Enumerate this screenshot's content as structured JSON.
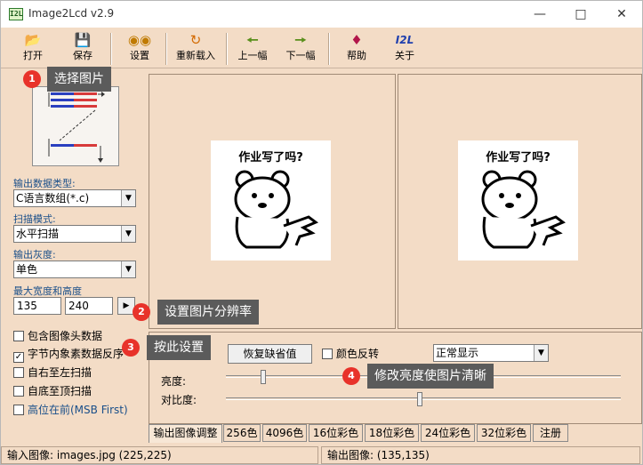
{
  "window": {
    "title": "Image2Lcd v2.9",
    "icon_text": "I2L"
  },
  "toolbar": {
    "open": "打开",
    "save": "保存",
    "settings": "设置",
    "reload": "重新载入",
    "prev": "上一幅",
    "next": "下一幅",
    "help": "帮助",
    "about": "关于",
    "about_icon": "I2L"
  },
  "left": {
    "output_type_label": "输出数据类型:",
    "output_type_value": "C语言数组(*.c)",
    "scan_mode_label": "扫描模式:",
    "scan_mode_value": "水平扫描",
    "gray_label": "输出灰度:",
    "gray_value": "单色",
    "size_label": "最大宽度和高度",
    "width": "135",
    "height": "240",
    "checks": [
      {
        "label": "包含图像头数据",
        "checked": false
      },
      {
        "label": "字节内象素数据反序",
        "checked": true
      },
      {
        "label": "自右至左扫描",
        "checked": false
      },
      {
        "label": "自底至顶扫描",
        "checked": false
      },
      {
        "label": "高位在前(MSB First)",
        "checked": false
      }
    ]
  },
  "preview": {
    "input_caption": "作业写了吗?",
    "output_caption": "作业写了吗?"
  },
  "controls": {
    "restore_default": "恢复缺省值",
    "invert_colors": "颜色反转",
    "display_mode": "正常显示",
    "brightness_label": "亮度:",
    "contrast_label": "对比度:",
    "brightness_level": 0.09,
    "contrast_level": 0.49
  },
  "tabs": [
    "输出图像调整",
    "256色",
    "4096色",
    "16位彩色",
    "18位彩色",
    "24位彩色",
    "32位彩色",
    "注册"
  ],
  "status": {
    "input": "输入图像: images.jpg (225,225)",
    "output": "输出图像: (135,135)"
  },
  "callouts": [
    {
      "num": "1",
      "text": "选择图片"
    },
    {
      "num": "2",
      "text": "设置图片分辨率"
    },
    {
      "num": "3",
      "text": "按此设置"
    },
    {
      "num": "4",
      "text": "修改亮度使图片清晰"
    }
  ],
  "colors": {
    "accent_badge": "#e8322a",
    "callout_bg": "#5b5b5b",
    "window_bg": "#f3dcc6"
  }
}
